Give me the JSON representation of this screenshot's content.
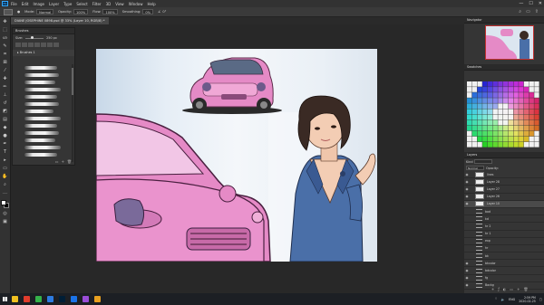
{
  "menubar": {
    "app_logo": "Ps",
    "items": [
      "File",
      "Edit",
      "Image",
      "Layer",
      "Type",
      "Select",
      "Filter",
      "3D",
      "View",
      "Window",
      "Help"
    ],
    "window_controls": [
      "—",
      "☐",
      "✕"
    ]
  },
  "options": {
    "mode_label": "Mode:",
    "mode_value": "Normal",
    "opacity_label": "Opacity:",
    "opacity_value": "100%",
    "flow_label": "Flow:",
    "flow_value": "100%",
    "smoothing_label": "Smoothing:",
    "smoothing_value": "0%",
    "angle_value": "0°"
  },
  "document": {
    "tab_title": "DIANE JOSEPHINE 0898.psd @ 33% (Layer 10, RGB/8) *"
  },
  "brushes_panel": {
    "title": "Brushes",
    "size_label": "Size:",
    "size_value": "250 px",
    "folder_name": "Brushes 1"
  },
  "right_panels": {
    "navigator_title": "Navigator",
    "swatches_title": "Swatches",
    "layers_title": "Layers",
    "kind_label": "Kind",
    "blend_mode": "Normal",
    "opacity_label": "Opacity:",
    "fill_label": "Fill:",
    "layers": [
      {
        "name": "lines",
        "visible": true,
        "type": "layer",
        "active": false
      },
      {
        "name": "Layer 28",
        "visible": true,
        "type": "layer",
        "active": false
      },
      {
        "name": "Layer 27",
        "visible": true,
        "type": "layer",
        "active": false
      },
      {
        "name": "Layer 26",
        "visible": true,
        "type": "layer",
        "active": false
      },
      {
        "name": "Layer 10",
        "visible": true,
        "type": "layer",
        "active": true
      },
      {
        "name": "bod",
        "visible": false,
        "type": "folder",
        "active": false
      },
      {
        "name": "kd",
        "visible": false,
        "type": "folder",
        "active": false
      },
      {
        "name": "hr 2",
        "visible": false,
        "type": "folder",
        "active": false
      },
      {
        "name": "hr 1",
        "visible": false,
        "type": "folder",
        "active": false
      },
      {
        "name": "exp",
        "visible": false,
        "type": "folder",
        "active": false
      },
      {
        "name": "hr",
        "visible": false,
        "type": "folder",
        "active": false
      },
      {
        "name": "bk",
        "visible": false,
        "type": "folder",
        "active": false
      },
      {
        "name": "bkcolor",
        "visible": true,
        "type": "folder",
        "active": false
      },
      {
        "name": "bdcolor",
        "visible": true,
        "type": "folder",
        "active": false
      },
      {
        "name": "fg",
        "visible": true,
        "type": "folder",
        "active": false
      },
      {
        "name": "Backg",
        "visible": true,
        "type": "folder",
        "active": false
      }
    ]
  },
  "taskbar": {
    "time": "2:59 PM",
    "date": "2020-02-25",
    "lang": "ENG",
    "app_colors": [
      "#f0c020",
      "#e03c2c",
      "#35b24a",
      "#2d7be0",
      "#001e36",
      "#1a73e8",
      "#9a4dd8",
      "#e8a020"
    ]
  },
  "colors": {
    "accent_blue": "#31a8ff",
    "car_pink": "#e58ac6",
    "woman_suit": "#4a6fa8"
  }
}
